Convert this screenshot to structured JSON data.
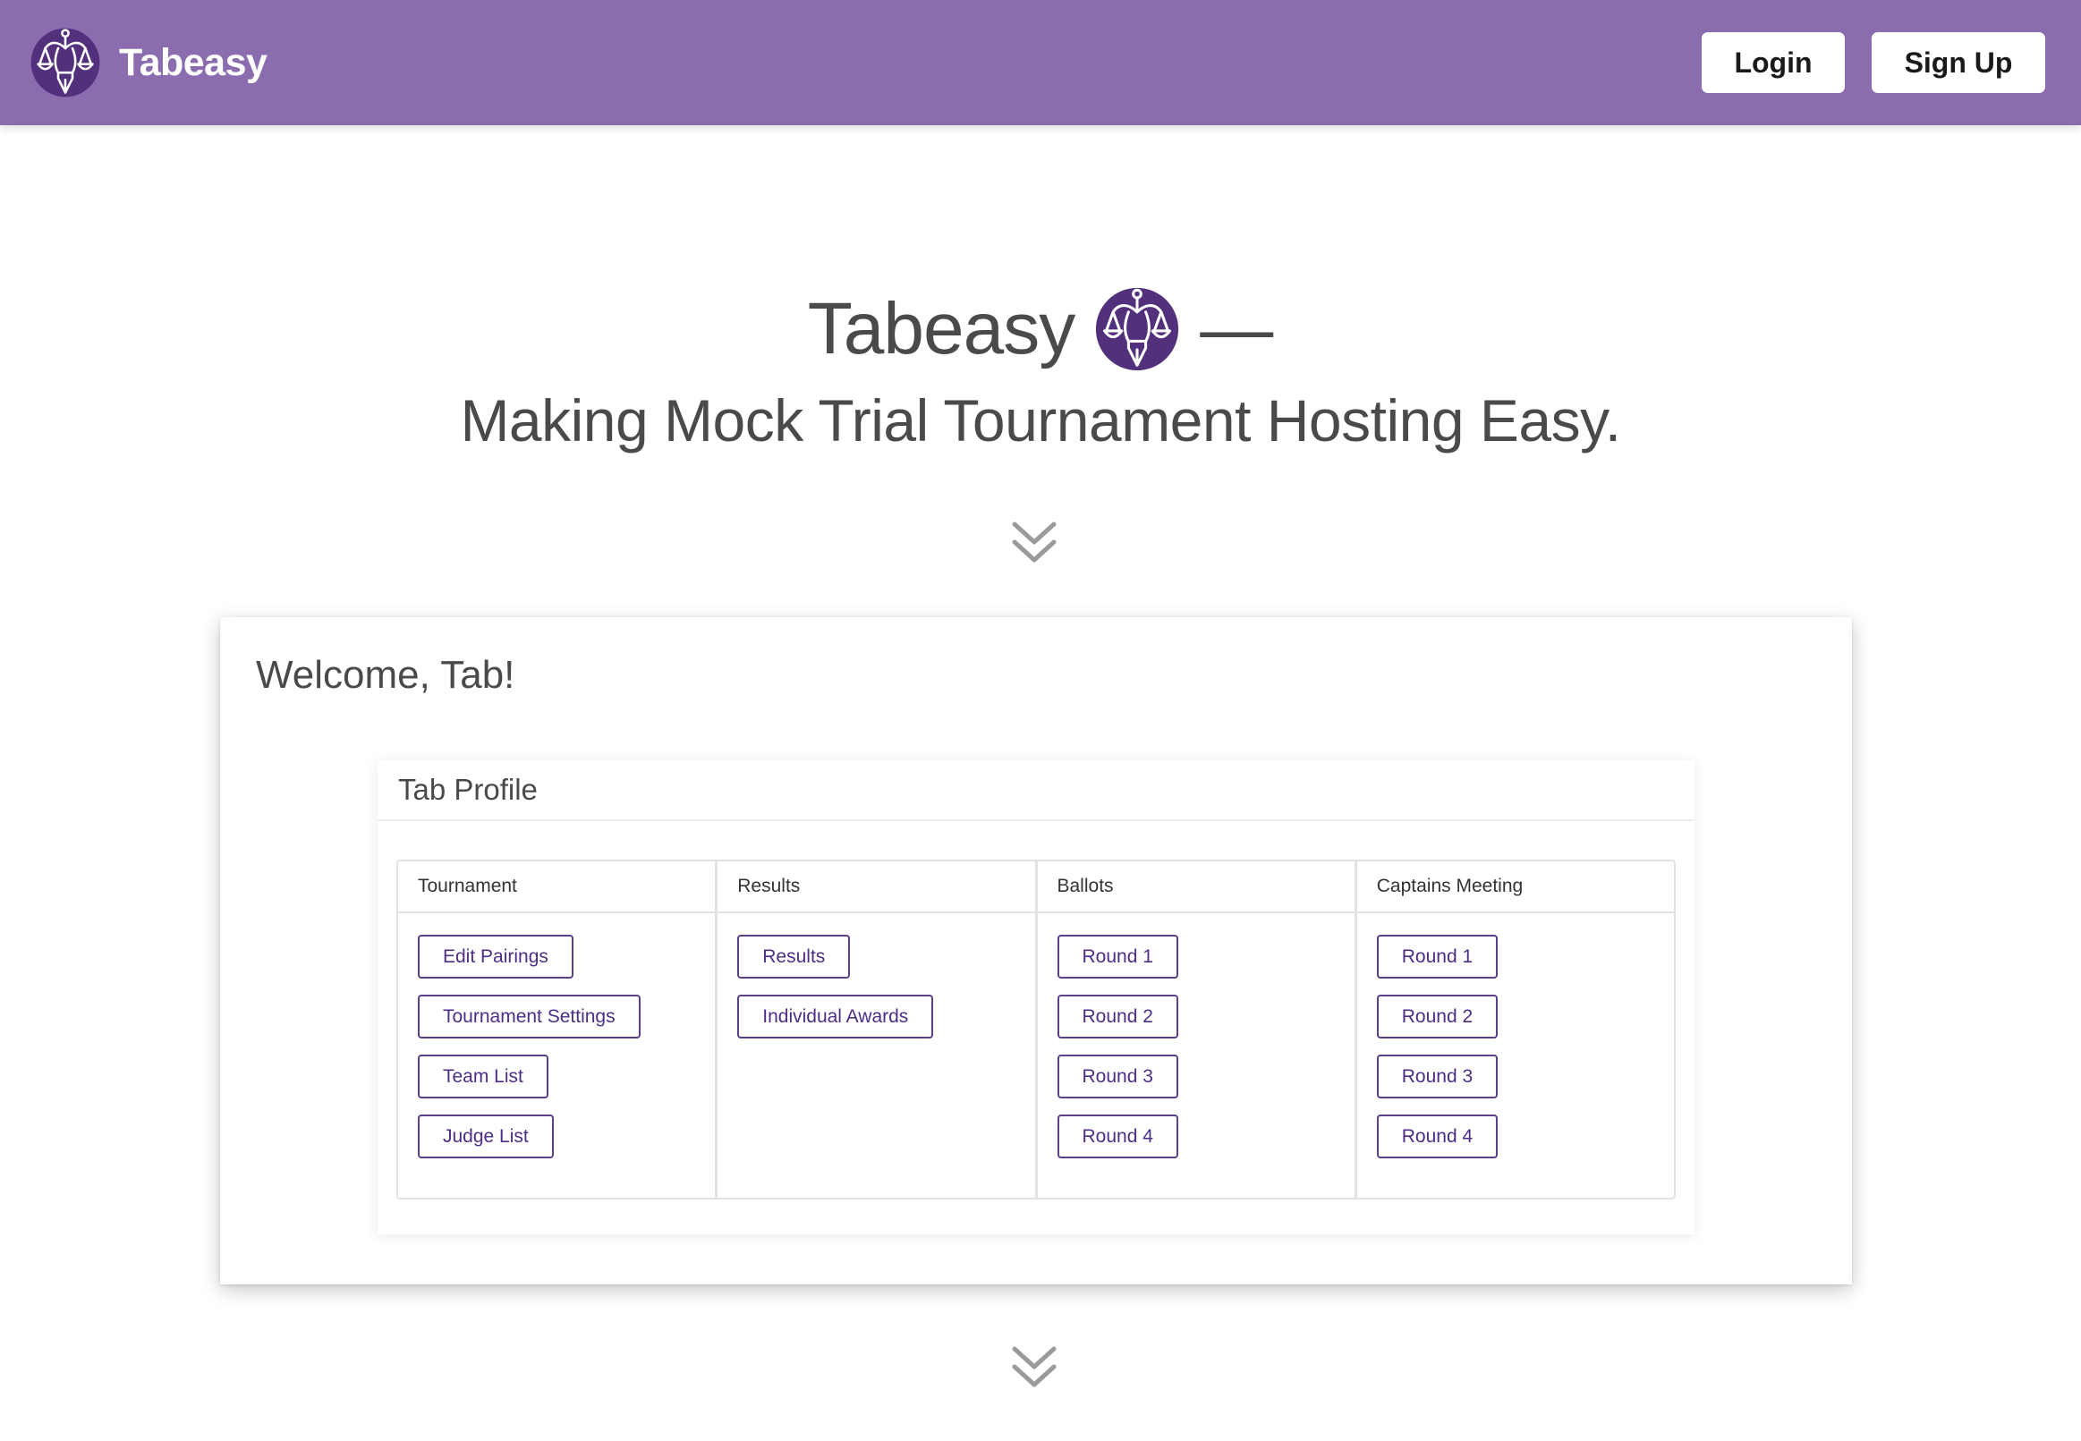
{
  "navbar": {
    "brand": "Tabeasy",
    "login_label": "Login",
    "signup_label": "Sign Up",
    "background": "#8b6daf"
  },
  "hero": {
    "title": "Tabeasy",
    "dash": "—",
    "subtitle": "Making Mock Trial Tournament Hosting Easy."
  },
  "demo": {
    "welcome": "Welcome, Tab!",
    "panel_title": "Tab Profile",
    "columns": [
      {
        "header": "Tournament",
        "buttons": [
          "Edit Pairings",
          "Tournament Settings",
          "Team List",
          "Judge List"
        ]
      },
      {
        "header": "Results",
        "buttons": [
          "Results",
          "Individual Awards"
        ]
      },
      {
        "header": "Ballots",
        "buttons": [
          "Round 1",
          "Round 2",
          "Round 3",
          "Round 4"
        ]
      },
      {
        "header": "Captains Meeting",
        "buttons": [
          "Round 1",
          "Round 2",
          "Round 3",
          "Round 4"
        ]
      }
    ]
  },
  "icons": {
    "logo": "scales-of-justice-pen-logo",
    "scroll": "double-chevron-down-icon"
  },
  "colors": {
    "accent": "#4d2d86",
    "logo_purple": "#52307c"
  }
}
